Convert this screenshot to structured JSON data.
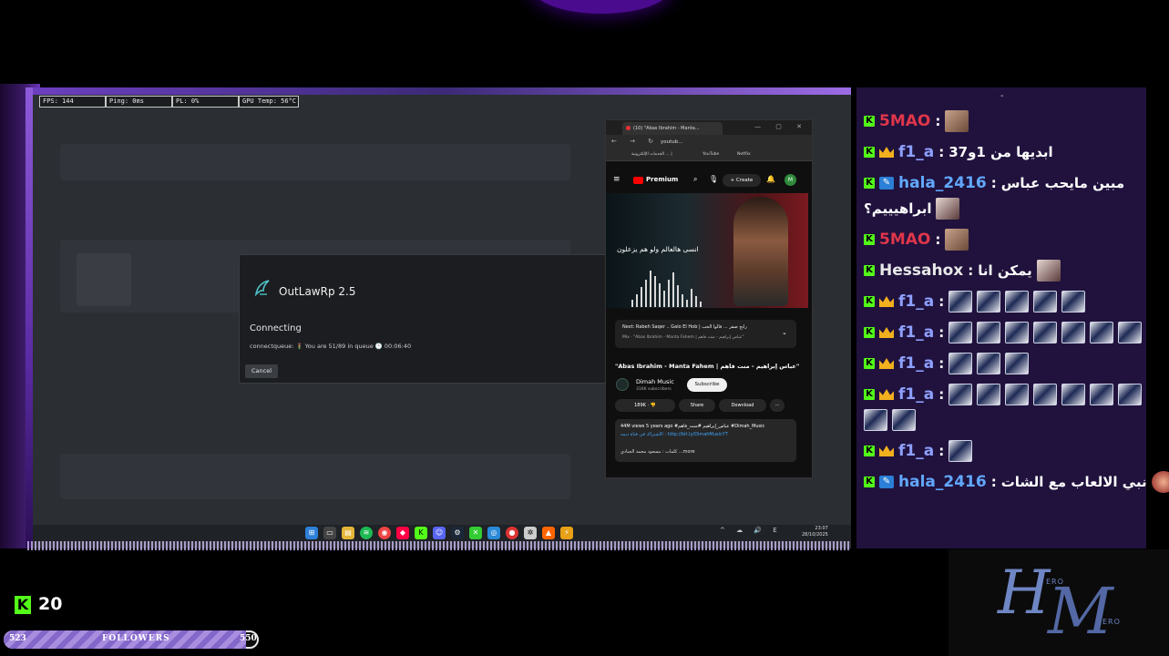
{
  "overlay_stats": [
    "FPS: 144",
    "Ping: 0ms",
    "PL: 0%",
    "GPU Temp: 56°C"
  ],
  "launcher": {
    "title": "OutLawRp 2.5",
    "status": "Connecting",
    "queue_text": "connectqueue: 🚦 You are 51/89 in queue 🕒 00:06:40",
    "cancel_label": "Cancel"
  },
  "browser": {
    "tab_title": "(10) \"Abas Ibrahim - Manta...",
    "url": "youtub...",
    "bookmarks": [
      "الخدمات الإلكترونية ... |",
      "YouTube",
      "Netflix"
    ],
    "yt_brand": "Premium",
    "create_label": "+ Create",
    "avatar_letter": "M",
    "thumbnail_text": "انسى هالعالم ولو هم يزعلون",
    "next_title": "Next: Rabeh Saqer .. Galo El Hob | رابح صقر ... قالوا الحب",
    "next_sub": "Mix · \"Abas Ibrahim - Manta Fahem | عباس إبراهيم - منت فاهم\"",
    "video_title": "\"Abas Ibrahim - Manta Fahem | عباس إبراهيم - منت فاهم\"",
    "channel_name": "Dimah Music",
    "channel_subs": "316K subscribers",
    "subscribe_label": "Subscribe",
    "likes": "189K",
    "share_label": "Share",
    "download_label": "Download",
    "desc_line1": "44M views  5 years ago  #عباس_إبراهيم  #منت_فاهم  #Dimah_Music",
    "desc_line2": "الاشتراك في قناة ديمه : http://bit.ly/DimahMusicYT",
    "desc_line3": "كلمات : مسعود محمد الجبادي ...more"
  },
  "taskbar": {
    "tray": "^ ☁ 🔊 E",
    "time": "23:07",
    "date": "28/10/2025"
  },
  "chat": {
    "messages": [
      {
        "user": "5MAO",
        "user_color": "#e0364a",
        "badges": [
          "kick"
        ],
        "text": "",
        "emotes": [
          "face"
        ]
      },
      {
        "user": "f1_a",
        "user_color": "#8ea0ff",
        "badges": [
          "kick",
          "crown"
        ],
        "text": "ابديها من 1و37",
        "emotes": []
      },
      {
        "user": "hala_2416",
        "user_color": "#62a8ff",
        "badges": [
          "kick",
          "pen"
        ],
        "text": "مبين مايحب عباس",
        "emotes": []
      },
      {
        "user": "",
        "user_color": "#fff",
        "badges": [],
        "text": "ابراهيييم؟",
        "emotes": [
          "girl"
        ]
      },
      {
        "user": "5MAO",
        "user_color": "#e0364a",
        "badges": [
          "kick"
        ],
        "text": "",
        "emotes": [
          "face"
        ]
      },
      {
        "user": "Hessahox",
        "user_color": "#e8e8e8",
        "badges": [
          "kick"
        ],
        "text": "يمكن انا",
        "emotes": [
          "girl"
        ]
      },
      {
        "user": "f1_a",
        "user_color": "#8ea0ff",
        "badges": [
          "kick",
          "crown"
        ],
        "text": "",
        "emotes": [
          "card",
          "card",
          "card",
          "card",
          "card"
        ]
      },
      {
        "user": "f1_a",
        "user_color": "#8ea0ff",
        "badges": [
          "kick",
          "crown"
        ],
        "text": "",
        "emotes": [
          "card",
          "card",
          "card",
          "card",
          "card",
          "card",
          "card"
        ]
      },
      {
        "user": "f1_a",
        "user_color": "#8ea0ff",
        "badges": [
          "kick",
          "crown"
        ],
        "text": "",
        "emotes": [
          "card",
          "card",
          "card"
        ]
      },
      {
        "user": "f1_a",
        "user_color": "#8ea0ff",
        "badges": [
          "kick",
          "crown"
        ],
        "text": "",
        "emotes": [
          "card",
          "card",
          "card",
          "card",
          "card",
          "card",
          "card"
        ]
      },
      {
        "user": "",
        "user_color": "#fff",
        "badges": [],
        "text": "",
        "emotes": [
          "card",
          "card"
        ]
      },
      {
        "user": "f1_a",
        "user_color": "#8ea0ff",
        "badges": [
          "kick",
          "crown"
        ],
        "text": "",
        "emotes": [
          "card"
        ]
      },
      {
        "user": "hala_2416",
        "user_color": "#62a8ff",
        "badges": [
          "kick",
          "pen"
        ],
        "text": "نبي الالعاب مع الشات",
        "emotes": [
          "red"
        ]
      }
    ]
  },
  "kick_count": "20",
  "followers": {
    "current": "523",
    "label": "FOLLOWERS",
    "goal": "550",
    "progress": 0.95
  },
  "logo": {
    "text_top": "ERO",
    "text_bottom": "ERO"
  }
}
